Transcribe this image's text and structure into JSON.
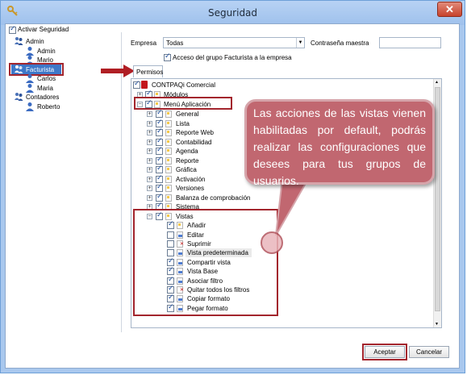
{
  "window": {
    "title": "Seguridad",
    "close_glyph": "✕"
  },
  "left_panel": {
    "activar_label": "Activar Seguridad",
    "groups": [
      {
        "name": "Admin",
        "users": [
          "Admin",
          "Mario"
        ]
      },
      {
        "name": "Facturista",
        "users": [
          "Carlos",
          "Maria"
        ]
      },
      {
        "name": "Contadores",
        "users": [
          "Roberto"
        ]
      }
    ]
  },
  "form": {
    "empresa_label": "Empresa",
    "empresa_value": "Todas",
    "password_label": "Contraseña maestra",
    "password_value": "",
    "acceso_label": "Acceso del grupo Facturista a la empresa"
  },
  "tabs": {
    "permisos": "Permisos"
  },
  "tree": {
    "root": "CONTPAQi Comercial",
    "modulos": "Módulos",
    "menu": "Menú Aplicación",
    "items": [
      "General",
      "Lista",
      "Reporte Web",
      "Contabilidad",
      "Agenda",
      "Reporte",
      "Gráfica",
      "Activación",
      "Versiones",
      "Balanza de comprobación",
      "Sistema"
    ],
    "vistas": "Vistas",
    "vistas_items": [
      "Añadir",
      "Editar",
      "Suprimir",
      "Vista predeterminada",
      "Compartir vista",
      "Vista Base",
      "Asociar filtro",
      "Quitar todos los filtros",
      "Copiar formato",
      "Pegar formato"
    ]
  },
  "callout_text": "Las acciones de las vistas vienen habilitadas por default, podrás realizar las configuraciones que desees para tus grupos de usuarios.",
  "buttons": {
    "accept": "Aceptar",
    "cancel": "Cancelar"
  },
  "colors": {
    "highlight_red": "#a3252d",
    "callout": "#c16770",
    "selection": "#3e78c9"
  }
}
